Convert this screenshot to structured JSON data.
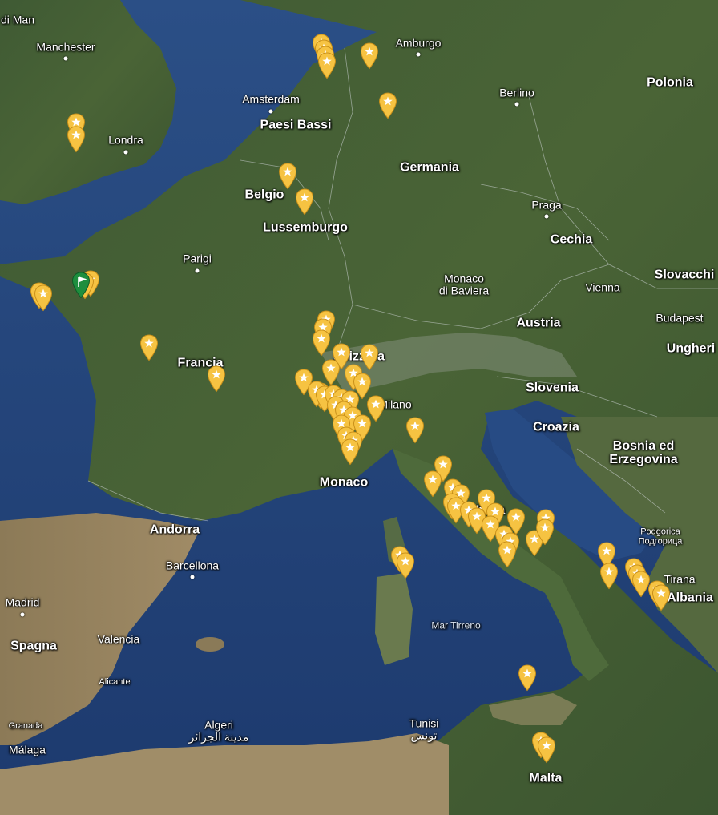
{
  "map": {
    "labels": [
      {
        "name": "label-isle-of-man",
        "text": "di Man",
        "kind": "city"
      },
      {
        "name": "label-manchester",
        "text": "Manchester",
        "kind": "city"
      },
      {
        "name": "label-londra",
        "text": "Londra",
        "kind": "city"
      },
      {
        "name": "label-amburgo",
        "text": "Amburgo",
        "kind": "city"
      },
      {
        "name": "label-amsterdam",
        "text": "Amsterdam",
        "kind": "city"
      },
      {
        "name": "label-paesi-bassi",
        "text": "Paesi Bassi",
        "kind": "country"
      },
      {
        "name": "label-berlino",
        "text": "Berlino",
        "kind": "city"
      },
      {
        "name": "label-polonia",
        "text": "Polonia",
        "kind": "country"
      },
      {
        "name": "label-germania",
        "text": "Germania",
        "kind": "country"
      },
      {
        "name": "label-belgio",
        "text": "Belgio",
        "kind": "country"
      },
      {
        "name": "label-lussemburgo",
        "text": "Lussemburgo",
        "kind": "country"
      },
      {
        "name": "label-praga",
        "text": "Praga",
        "kind": "city"
      },
      {
        "name": "label-cechia",
        "text": "Cechia",
        "kind": "country"
      },
      {
        "name": "label-parigi",
        "text": "Parigi",
        "kind": "city"
      },
      {
        "name": "label-monaco-di-baviera",
        "text": "Monaco\ndi Baviera",
        "kind": "city"
      },
      {
        "name": "label-vienna",
        "text": "Vienna",
        "kind": "city"
      },
      {
        "name": "label-slovacchia",
        "text": "Slovacchi",
        "kind": "country"
      },
      {
        "name": "label-budapest",
        "text": "Budapest",
        "kind": "city"
      },
      {
        "name": "label-austria",
        "text": "Austria",
        "kind": "country"
      },
      {
        "name": "label-ungheria",
        "text": "Ungheri",
        "kind": "country"
      },
      {
        "name": "label-francia",
        "text": "Francia",
        "kind": "country"
      },
      {
        "name": "label-svizzera",
        "text": "Svizzera",
        "kind": "country"
      },
      {
        "name": "label-milano",
        "text": "Milano",
        "kind": "city"
      },
      {
        "name": "label-slovenia",
        "text": "Slovenia",
        "kind": "country"
      },
      {
        "name": "label-croazia",
        "text": "Croazia",
        "kind": "country"
      },
      {
        "name": "label-bosnia",
        "text": "Bosnia ed\nErzegovina",
        "kind": "country"
      },
      {
        "name": "label-monaco",
        "text": "Monaco",
        "kind": "country"
      },
      {
        "name": "label-italia",
        "text": "Italia",
        "kind": "country"
      },
      {
        "name": "label-andorra",
        "text": "Andorra",
        "kind": "country"
      },
      {
        "name": "label-podgorica",
        "text": "Podgorica\nПодгорица",
        "kind": "small"
      },
      {
        "name": "label-barcellona",
        "text": "Barcellona",
        "kind": "city"
      },
      {
        "name": "label-tirana",
        "text": "Tirana",
        "kind": "city"
      },
      {
        "name": "label-albania",
        "text": "Albania",
        "kind": "country"
      },
      {
        "name": "label-madrid",
        "text": "Madrid",
        "kind": "city"
      },
      {
        "name": "label-spagna",
        "text": "Spagna",
        "kind": "country"
      },
      {
        "name": "label-valencia",
        "text": "Valencia",
        "kind": "city"
      },
      {
        "name": "label-mar-tirreno",
        "text": "Mar Tirreno",
        "kind": "sea"
      },
      {
        "name": "label-alicante",
        "text": "Alicante",
        "kind": "small"
      },
      {
        "name": "label-algeri",
        "text": "Algeri\nمدينة الجزائر",
        "kind": "city"
      },
      {
        "name": "label-tunisi",
        "text": "Tunisi\nتونس",
        "kind": "city"
      },
      {
        "name": "label-granada",
        "text": "Granada",
        "kind": "small"
      },
      {
        "name": "label-malaga",
        "text": "Málaga",
        "kind": "city"
      },
      {
        "name": "label-malta",
        "text": "Malta",
        "kind": "country"
      }
    ],
    "pin_colors": {
      "place": "#f6c342",
      "place_stroke": "#c9901a",
      "start": "#1e8e3e",
      "start_stroke": "#0d5c26"
    }
  }
}
